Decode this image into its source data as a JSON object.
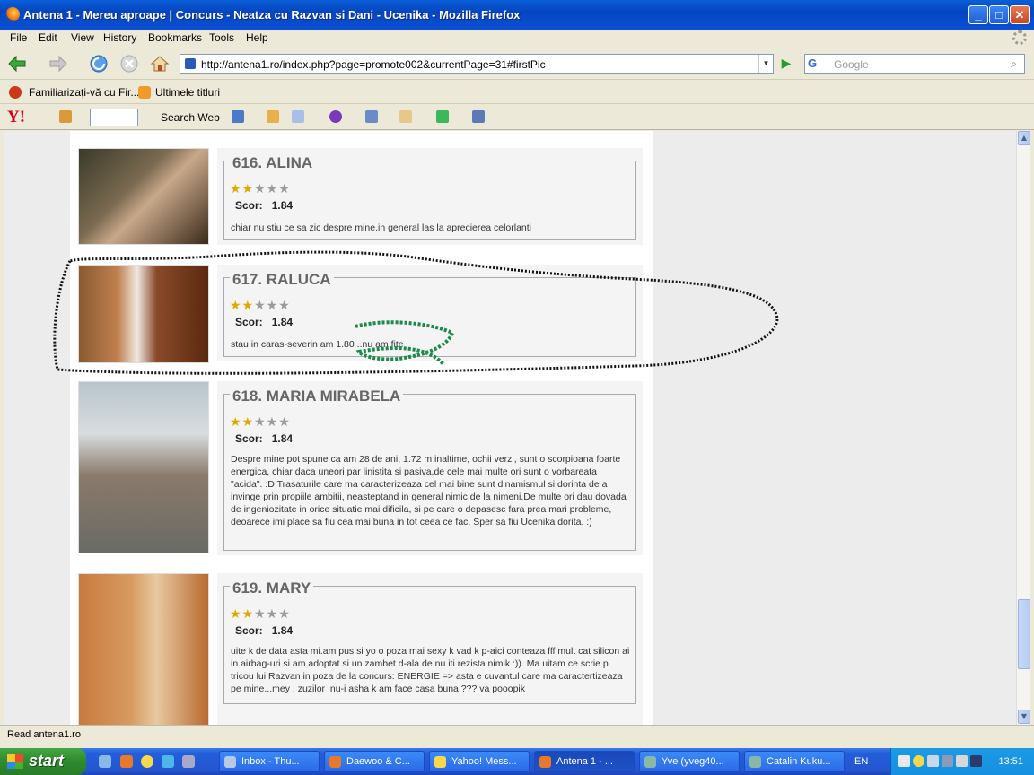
{
  "window": {
    "title": "Antena 1 - Mereu aproape | Concurs - Neatza cu Razvan si Dani - Ucenika - Mozilla Firefox"
  },
  "menu": [
    "File",
    "Edit",
    "View",
    "History",
    "Bookmarks",
    "Tools",
    "Help"
  ],
  "nav": {
    "url": "http://antena1.ro/index.php?page=promote002&currentPage=31#firstPic",
    "search_placeholder": "Google"
  },
  "bookmarks": [
    "Familiarizați-vă cu Fir...",
    "Ultimele titluri"
  ],
  "yahoo": {
    "search_label": "Search Web"
  },
  "entries": [
    {
      "title": "616. ALINA",
      "rating": 2,
      "max_rating": 5,
      "score_label": "Scor:",
      "score": "1.84",
      "description": "chiar nu stiu ce sa zic despre mine.in general las la aprecierea celorlanti"
    },
    {
      "title": "617. RALUCA",
      "rating": 2,
      "max_rating": 5,
      "score_label": "Scor:",
      "score": "1.84",
      "description": "stau in caras-severin am 1.80 ..nu am fite"
    },
    {
      "title": "618. MARIA MIRABELA",
      "rating": 2,
      "max_rating": 5,
      "score_label": "Scor:",
      "score": "1.84",
      "description": "Despre mine pot spune ca am 28 de ani, 1.72 m inaltime, ochii verzi, sunt o scorpioana foarte energica, chiar daca uneori par linistita si pasiva,de cele mai multe ori sunt o vorbareata \"acida\". :D Trasaturile care ma caracterizeaza cel mai bine sunt dinamismul si dorinta de a invinge prin propiile ambitii, neasteptand in general nimic de la nimeni.De multe ori dau dovada de ingeniozitate in orice situatie mai dificila, si pe care o depasesc fara prea mari probleme, deoarece imi place sa fiu cea mai buna in tot ceea ce fac. Sper sa fiu Ucenika dorita. :)"
    },
    {
      "title": "619. MARY",
      "rating": 2,
      "max_rating": 5,
      "score_label": "Scor:",
      "score": "1.84",
      "description": "uite k de data asta mi.am pus si yo o poza mai sexy k vad k p-aici conteaza fff mult cat silicon ai in airbag-uri si am adoptat si un zambet d-ala de nu iti rezista nimik :)). Ma uitam ce scrie p tricou lui Razvan in poza de la concurs: ENERGIE => asta e cuvantul care ma caractertizeaza pe mine...mey , zuzilor ,nu-i asha k am face casa buna ??? va pooopik"
    }
  ],
  "status": "Read antena1.ro",
  "taskbar": {
    "start": "start",
    "tasks": [
      "Inbox - Thu...",
      "Daewoo & C...",
      "Yahoo! Mess...",
      "Antena 1 - ...",
      "Yve (yveg40...",
      "Catalin Kuku..."
    ],
    "active_task": 3,
    "language": "EN",
    "clock": "13:51"
  }
}
